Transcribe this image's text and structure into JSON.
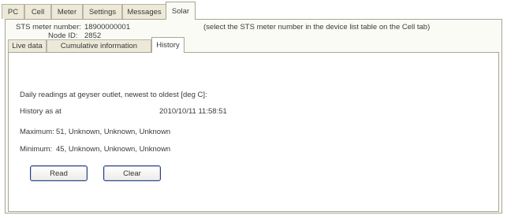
{
  "tabs": [
    "PC",
    "Cell",
    "Meter",
    "Settings",
    "Messages",
    "Solar"
  ],
  "active_tab": "Solar",
  "meter": {
    "sts_label": "STS meter number:",
    "sts_value": "18900000001",
    "node_label": "Node ID:",
    "node_value": "2852",
    "hint": "(select the STS meter number in the device list table on the Cell tab)"
  },
  "subtabs": [
    "Live data",
    "Cumulative information",
    "History"
  ],
  "active_subtab": "History",
  "history": {
    "description": "Daily readings at geyser outlet, newest to oldest [deg C]:",
    "as_at_label": "History as at",
    "as_at_value": "2010/10/11 11:58:51",
    "max_label": "Maximum:",
    "max_value": "51, Unknown, Unknown, Unknown",
    "min_label": "Minimum:",
    "min_value": "45, Unknown, Unknown, Unknown"
  },
  "buttons": {
    "read": "Read",
    "clear": "Clear"
  }
}
